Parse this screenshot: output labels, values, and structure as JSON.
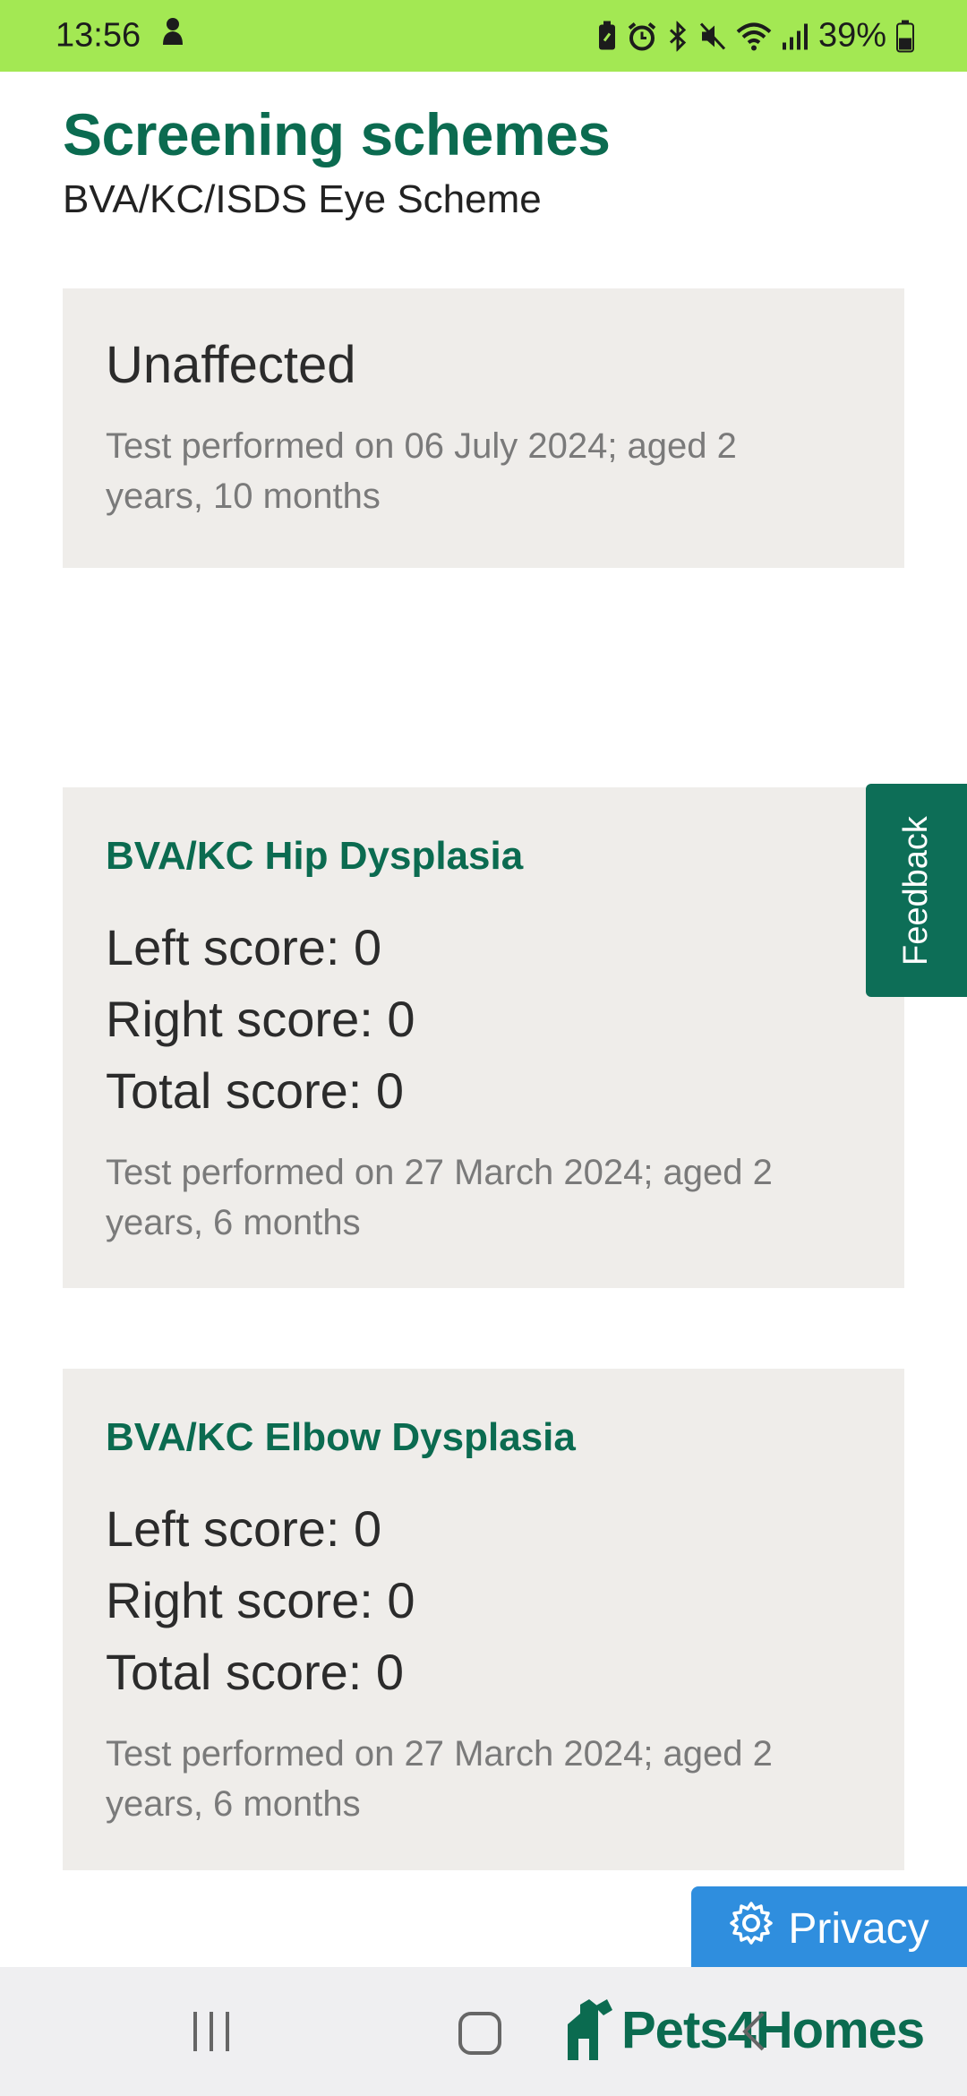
{
  "status_bar": {
    "time": "13:56",
    "battery": "39%",
    "icons": [
      "notification-mascot-icon",
      "battery-saver-icon",
      "alarm-icon",
      "bluetooth-icon",
      "mute-icon",
      "wifi-icon",
      "signal-icon",
      "battery-icon"
    ]
  },
  "header": {
    "title": "Screening schemes",
    "subtitle": "BVA/KC/ISDS Eye Scheme"
  },
  "cards": [
    {
      "result": "Unaffected",
      "meta": "Test performed on 06 July 2024; aged 2 years, 10 months"
    },
    {
      "heading": "BVA/KC Hip Dysplasia",
      "left": "Left score: 0",
      "right": "Right score: 0",
      "total": "Total score: 0",
      "meta": "Test performed on 27 March 2024; aged 2 years, 6 months"
    },
    {
      "heading": "BVA/KC Elbow Dysplasia",
      "left": "Left score: 0",
      "right": "Right score: 0",
      "total": "Total score: 0",
      "meta": "Test performed on 27 March 2024; aged 2 years, 6 months"
    }
  ],
  "feedback_label": "Feedback",
  "privacy_label": "Privacy",
  "brand": "Pets4Homes",
  "colors": {
    "status_bar": "#a3e853",
    "brand_green": "#0b6b50",
    "card_bg": "#efedea",
    "privacy_blue": "#2f8ede"
  }
}
